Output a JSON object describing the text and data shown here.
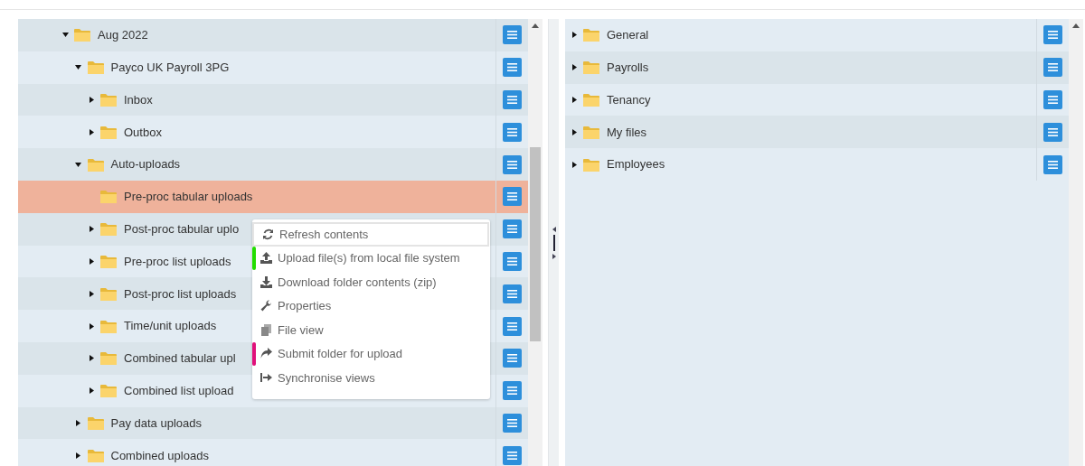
{
  "left_tree": [
    {
      "label": "Aug 2022",
      "expandable": true,
      "expanded": true,
      "selected": false,
      "children": [
        {
          "label": "Payco UK Payroll 3PG",
          "expandable": true,
          "expanded": true,
          "selected": false,
          "children": [
            {
              "label": "Inbox",
              "expandable": true,
              "expanded": false,
              "selected": false
            },
            {
              "label": "Outbox",
              "expandable": true,
              "expanded": false,
              "selected": false
            }
          ]
        },
        {
          "label": "Auto-uploads",
          "expandable": true,
          "expanded": true,
          "selected": false,
          "children": [
            {
              "label": "Pre-proc tabular uploads",
              "expandable": false,
              "selected": true
            },
            {
              "label": "Post-proc tabular uplo",
              "expandable": true,
              "expanded": false,
              "selected": false
            },
            {
              "label": "Pre-proc list uploads",
              "expandable": true,
              "expanded": false,
              "selected": false
            },
            {
              "label": "Post-proc list uploads",
              "expandable": true,
              "expanded": false,
              "selected": false
            },
            {
              "label": "Time/unit uploads",
              "expandable": true,
              "expanded": false,
              "selected": false
            },
            {
              "label": "Combined tabular upl",
              "expandable": true,
              "expanded": false,
              "selected": false
            },
            {
              "label": "Combined list upload",
              "expandable": true,
              "expanded": false,
              "selected": false
            }
          ]
        },
        {
          "label": "Pay data uploads",
          "expandable": true,
          "expanded": false,
          "selected": false
        },
        {
          "label": "Combined uploads",
          "expandable": true,
          "expanded": false,
          "selected": false
        }
      ]
    }
  ],
  "right_tree": [
    {
      "label": "General",
      "expandable": true,
      "expanded": false,
      "selected": false
    },
    {
      "label": "Payrolls",
      "expandable": true,
      "expanded": false,
      "selected": false
    },
    {
      "label": "Tenancy",
      "expandable": true,
      "expanded": false,
      "selected": false
    },
    {
      "label": "My files",
      "expandable": true,
      "expanded": false,
      "selected": false
    },
    {
      "label": "Employees",
      "expandable": true,
      "expanded": false,
      "selected": false
    }
  ],
  "context_menu": [
    {
      "kind": "refresh",
      "label": "Refresh contents",
      "selected": true
    },
    {
      "kind": "upload",
      "label": "Upload file(s) from local file system",
      "selected": false,
      "color": "#22dd00"
    },
    {
      "kind": "download",
      "label": "Download folder contents (zip)",
      "selected": false
    },
    {
      "kind": "wrench",
      "label": "Properties",
      "selected": false
    },
    {
      "kind": "files",
      "label": "File view",
      "selected": false
    },
    {
      "kind": "share",
      "label": "Submit folder for upload",
      "selected": false,
      "color": "#e0107a"
    },
    {
      "kind": "signin",
      "label": "Synchronise views",
      "selected": false
    }
  ]
}
